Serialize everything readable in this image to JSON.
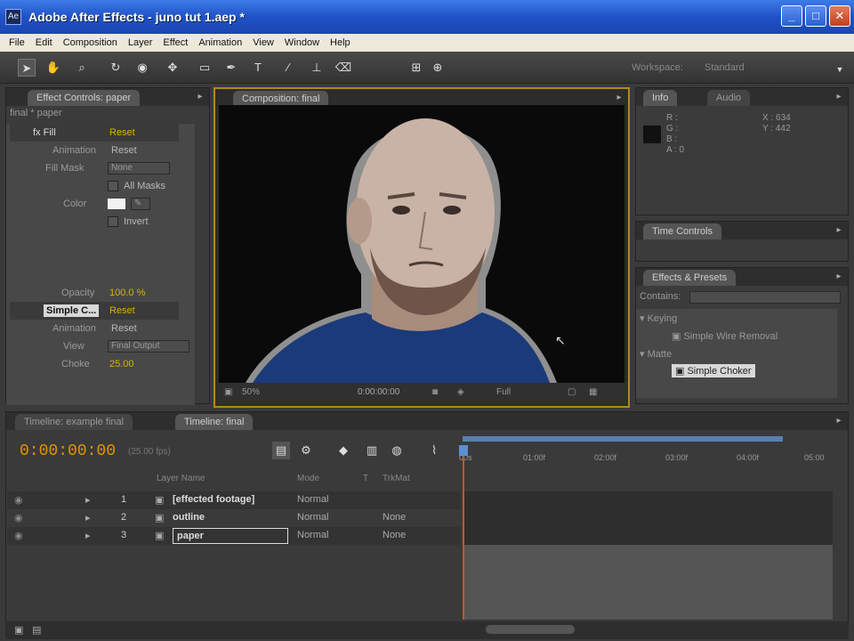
{
  "window": {
    "title": "Adobe After Effects - juno tut 1.aep *"
  },
  "menu": [
    "File",
    "Edit",
    "Composition",
    "Layer",
    "Effect",
    "Animation",
    "View",
    "Window",
    "Help"
  ],
  "toolbar": {
    "workspace_label": "Workspace:",
    "workspace_value": "Standard"
  },
  "effect_controls": {
    "tab": "Effect Controls: paper",
    "header": "final * paper",
    "rows": [
      {
        "label": "fx Fill",
        "value": "Reset"
      },
      {
        "label": "Animation",
        "value": "Reset"
      },
      {
        "label": "Fill Mask",
        "value": "None"
      },
      {
        "label": "",
        "value": "All Masks"
      },
      {
        "label": "Color",
        "value": ""
      },
      {
        "label": "",
        "value": "Invert"
      },
      {
        "label": "Opacity",
        "value": "100.0 %"
      },
      {
        "label": "Simple C...",
        "value": "Reset"
      },
      {
        "label": "Animation",
        "value": "Reset"
      },
      {
        "label": "View",
        "value": "Final Output"
      },
      {
        "label": "Choke",
        "value": "25.00"
      }
    ]
  },
  "composition": {
    "tab": "Composition: final",
    "zoom": "50%",
    "time": "0:00:00:00",
    "resolution": "Full"
  },
  "info": {
    "tab_info": "Info",
    "tab_audio": "Audio",
    "r": "R :",
    "g": "G :",
    "b": "B :",
    "a": "A : 0",
    "x": "X : 634",
    "y": "Y : 442"
  },
  "time_controls": {
    "tab": "Time Controls"
  },
  "effects_presets": {
    "tab": "Effects & Presets",
    "contains_label": "Contains:",
    "items": [
      {
        "label": "Keying"
      },
      {
        "label": "Simple Wire Removal"
      },
      {
        "label": "Matte"
      },
      {
        "label": "Simple Choker"
      }
    ]
  },
  "timeline": {
    "tab1": "Timeline: example final",
    "tab2": "Timeline: final",
    "timecode": "0:00:00:00",
    "fps": "(25.00 fps)",
    "col_layer_name": "Layer Name",
    "col_mode": "Mode",
    "col_t": "T",
    "col_trkmat": "TrkMat",
    "ruler": [
      "00s",
      "01:00f",
      "02:00f",
      "03:00f",
      "04:00f",
      "05:00"
    ],
    "layers": [
      {
        "num": "1",
        "name": "[effected footage]",
        "mode": "Normal",
        "matte": ""
      },
      {
        "num": "2",
        "name": "outline",
        "mode": "Normal",
        "matte": "None"
      },
      {
        "num": "3",
        "name": "paper",
        "mode": "Normal",
        "matte": "None"
      }
    ]
  }
}
